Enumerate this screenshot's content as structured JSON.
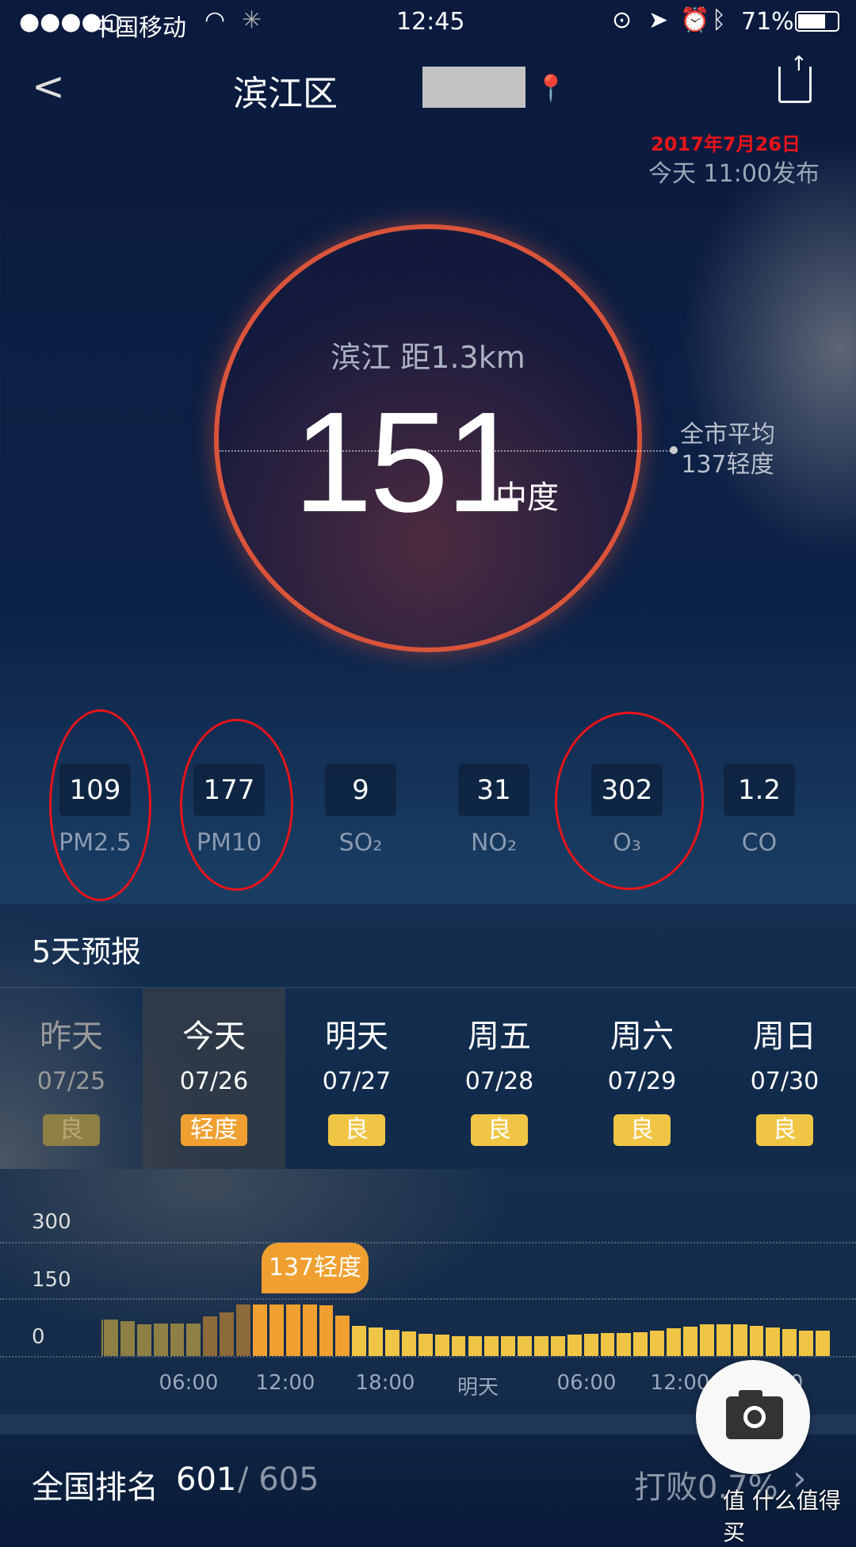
{
  "status_bar": {
    "signal": "●●●●○",
    "carrier": "中国移动",
    "time": "12:45",
    "battery": "71%"
  },
  "header": {
    "title": "滨江区",
    "date_annotation": "2017年7月26日",
    "published": "今天 11:00发布"
  },
  "aqi": {
    "station": "滨江 距1.3km",
    "value": "151",
    "level": "中度",
    "city_avg_label": "全市平均",
    "city_avg": "137轻度",
    "ring_color": "#d9543a"
  },
  "pollutants": [
    {
      "value": "109",
      "label": "PM2.5",
      "circled": true
    },
    {
      "value": "177",
      "label": "PM10",
      "circled": true
    },
    {
      "value": "9",
      "label": "SO₂",
      "circled": false
    },
    {
      "value": "31",
      "label": "NO₂",
      "circled": false
    },
    {
      "value": "302",
      "label": "O₃",
      "circled": true
    },
    {
      "value": "1.2",
      "label": "CO",
      "circled": false
    }
  ],
  "forecast": {
    "title": "5天预报",
    "days": [
      {
        "name": "昨天",
        "date": "07/25",
        "level": "良",
        "color": "#8e7f45"
      },
      {
        "name": "今天",
        "date": "07/26",
        "level": "轻度",
        "color": "#f0a030"
      },
      {
        "name": "明天",
        "date": "07/27",
        "level": "良",
        "color": "#f0c545"
      },
      {
        "name": "周五",
        "date": "07/28",
        "level": "良",
        "color": "#f0c545"
      },
      {
        "name": "周六",
        "date": "07/29",
        "level": "良",
        "color": "#f0c545"
      },
      {
        "name": "周日",
        "date": "07/30",
        "level": "良",
        "color": "#f0c545"
      }
    ]
  },
  "chart_data": {
    "type": "bar",
    "y_ticks": [
      "300",
      "150",
      "0"
    ],
    "ylim": [
      0,
      300
    ],
    "x_ticks": [
      "06:00",
      "12:00",
      "18:00",
      "明天",
      "06:00",
      "12:00",
      "18:00"
    ],
    "tooltip": "137轻度",
    "values": [
      95,
      91,
      83,
      84,
      84,
      84,
      102,
      114,
      134,
      134,
      134,
      134,
      134,
      131,
      105,
      79,
      74,
      68,
      63,
      58,
      55,
      51,
      51,
      52,
      52,
      52,
      52,
      52,
      55,
      58,
      59,
      60,
      62,
      66,
      71,
      77,
      82,
      83,
      82,
      79,
      75,
      70,
      66,
      65
    ],
    "colors": {
      "past": "#8e7f45",
      "past_recent": "#8d6a3a",
      "light": "#f0a030",
      "good": "#f0c545"
    }
  },
  "ranking": {
    "label": "全国排名",
    "rank": "601",
    "total": "/ 605",
    "beat": "打败0.7%"
  },
  "watermark": "值 什么值得买"
}
